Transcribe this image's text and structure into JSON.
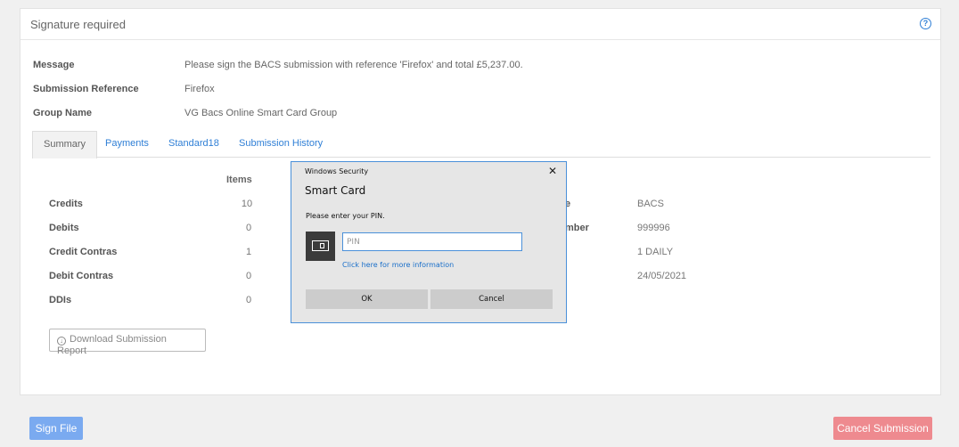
{
  "panel": {
    "title": "Signature required",
    "help_icon": "question-circle-icon"
  },
  "info": [
    {
      "label": "Message",
      "value": "Please sign the BACS submission with reference 'Firefox' and total £5,237.00."
    },
    {
      "label": "Submission Reference",
      "value": "Firefox"
    },
    {
      "label": "Group Name",
      "value": "VG Bacs Online Smart Card Group"
    }
  ],
  "tabs": [
    {
      "label": "Summary",
      "active": true
    },
    {
      "label": "Payments",
      "active": false
    },
    {
      "label": "Standard18",
      "active": false
    },
    {
      "label": "Submission History",
      "active": false
    }
  ],
  "summary": {
    "items_header": "Items",
    "rows": [
      {
        "label": "Credits",
        "items": "10"
      },
      {
        "label": "Debits",
        "items": "0"
      },
      {
        "label": "Credit Contras",
        "items": "1"
      },
      {
        "label": "Debit Contras",
        "items": "0"
      },
      {
        "label": "DDIs",
        "items": "0"
      }
    ],
    "right_rows": [
      {
        "label": "e",
        "value": "BACS"
      },
      {
        "label": "mber",
        "value": "999996"
      },
      {
        "label": "",
        "value": "1 DAILY"
      },
      {
        "label": "",
        "value": "24/05/2021"
      }
    ],
    "download_label": "Download Submission Report"
  },
  "footer": {
    "sign_label": "Sign File",
    "cancel_label": "Cancel Submission"
  },
  "dialog": {
    "caption": "Windows Security",
    "close_glyph": "✕",
    "title": "Smart Card",
    "prompt": "Please enter your PIN.",
    "pin_placeholder": "PIN",
    "link": "Click here for more information",
    "ok_label": "OK",
    "cancel_label": "Cancel"
  }
}
